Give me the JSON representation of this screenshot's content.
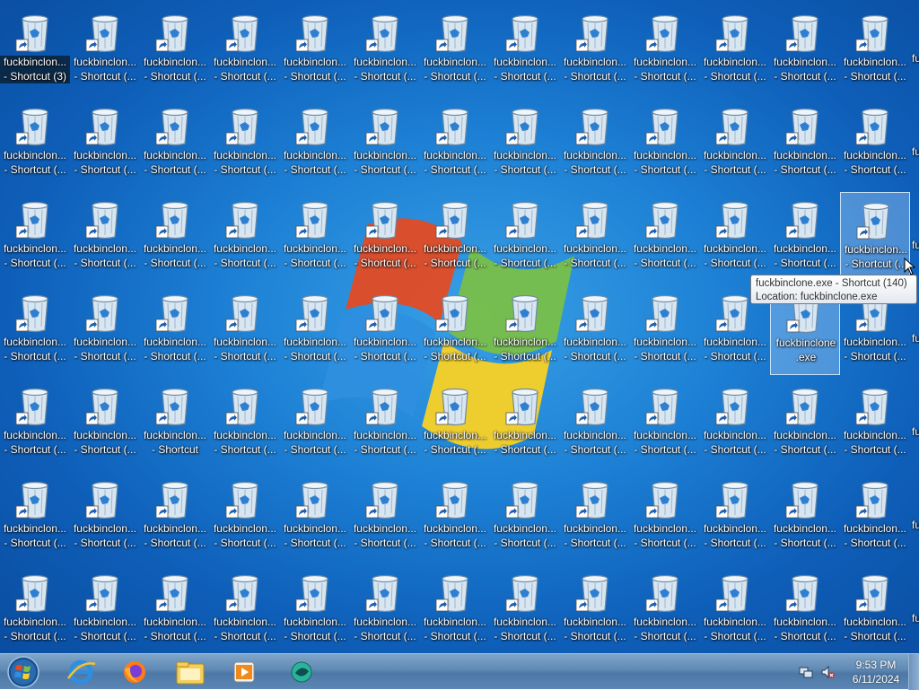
{
  "desktop": {
    "icon_name_truncated": "fuckbinclon...",
    "icon_line2_truncated": "- Shortcut (...",
    "icon_line2_focused": "- Shortcut (3)",
    "icon_line2_plain": "- Shortcut",
    "exe_icon_line1": "fuckbinclone",
    "exe_icon_line2": ".exe",
    "edge_fragment": "fu",
    "icon_image": "recycle-bin-icon",
    "shortcut_overlay": "shortcut-arrow-icon"
  },
  "tooltip": {
    "line1": "fuckbinclone.exe - Shortcut (140)",
    "line2": "Location: fuckbinclone.exe"
  },
  "taskbar": {
    "start": "windows-start-orb",
    "pinned": [
      {
        "name": "internet-explorer-icon"
      },
      {
        "name": "firefox-icon"
      },
      {
        "name": "windows-explorer-icon"
      },
      {
        "name": "media-player-icon"
      },
      {
        "name": "green-app-icon"
      }
    ],
    "tray": {
      "network_icon": "network-icon",
      "volume_icon": "volume-muted-icon",
      "time": "9:53 PM",
      "date": "6/11/2024"
    }
  },
  "colors": {
    "desktop_blue": "#1c7fd4",
    "taskbar": "#5f88b3",
    "logo_red": "#e8491d",
    "logo_green": "#7bc043",
    "logo_blue": "#2f8fe0",
    "logo_yellow": "#ffd21f"
  }
}
